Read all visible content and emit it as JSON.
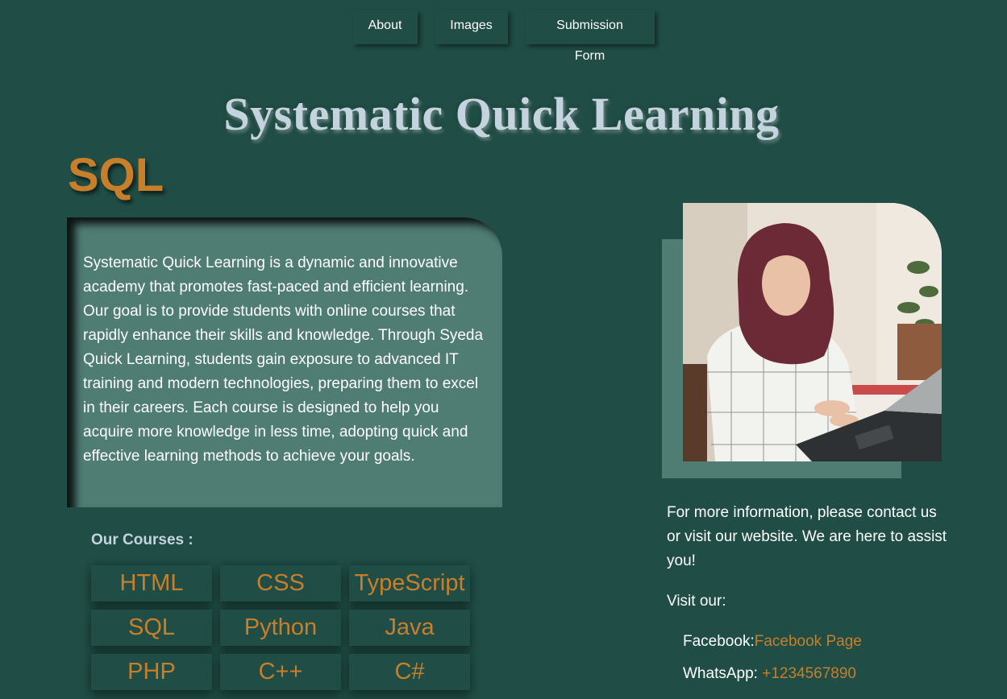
{
  "nav": {
    "items": [
      {
        "label": "About"
      },
      {
        "label": "Images"
      },
      {
        "label": "Submission Form"
      }
    ]
  },
  "header": {
    "title": "Systematic Quick Learning",
    "acronym": "SQL"
  },
  "about": {
    "text": "Systematic Quick Learning is a dynamic and innovative academy that promotes fast-paced and efficient learning. Our goal is to provide students with online courses that rapidly enhance their skills and knowledge. Through Syeda Quick Learning, students gain exposure to advanced IT training and modern technologies, preparing them to excel in their careers. Each course is designed to help you acquire more knowledge in less time, adopting quick and effective learning methods to achieve your goals."
  },
  "courses": {
    "heading": "Our Courses :",
    "items": [
      "HTML",
      "CSS",
      "TypeScript",
      "SQL",
      "Python",
      "Java",
      "PHP",
      "C++",
      "C#"
    ]
  },
  "contact": {
    "text": "For more information, please contact us or visit our website. We are here to assist you!",
    "visit_label": "Visit our:",
    "facebook_label": "Facebook:",
    "facebook_link": "Facebook Page",
    "whatsapp_label": "WhatsApp: ",
    "whatsapp_link": "+1234567890"
  },
  "colors": {
    "background": "#204d45",
    "panel": "#4f7c73",
    "accent": "#c77f2b",
    "title": "#c4d4de"
  }
}
